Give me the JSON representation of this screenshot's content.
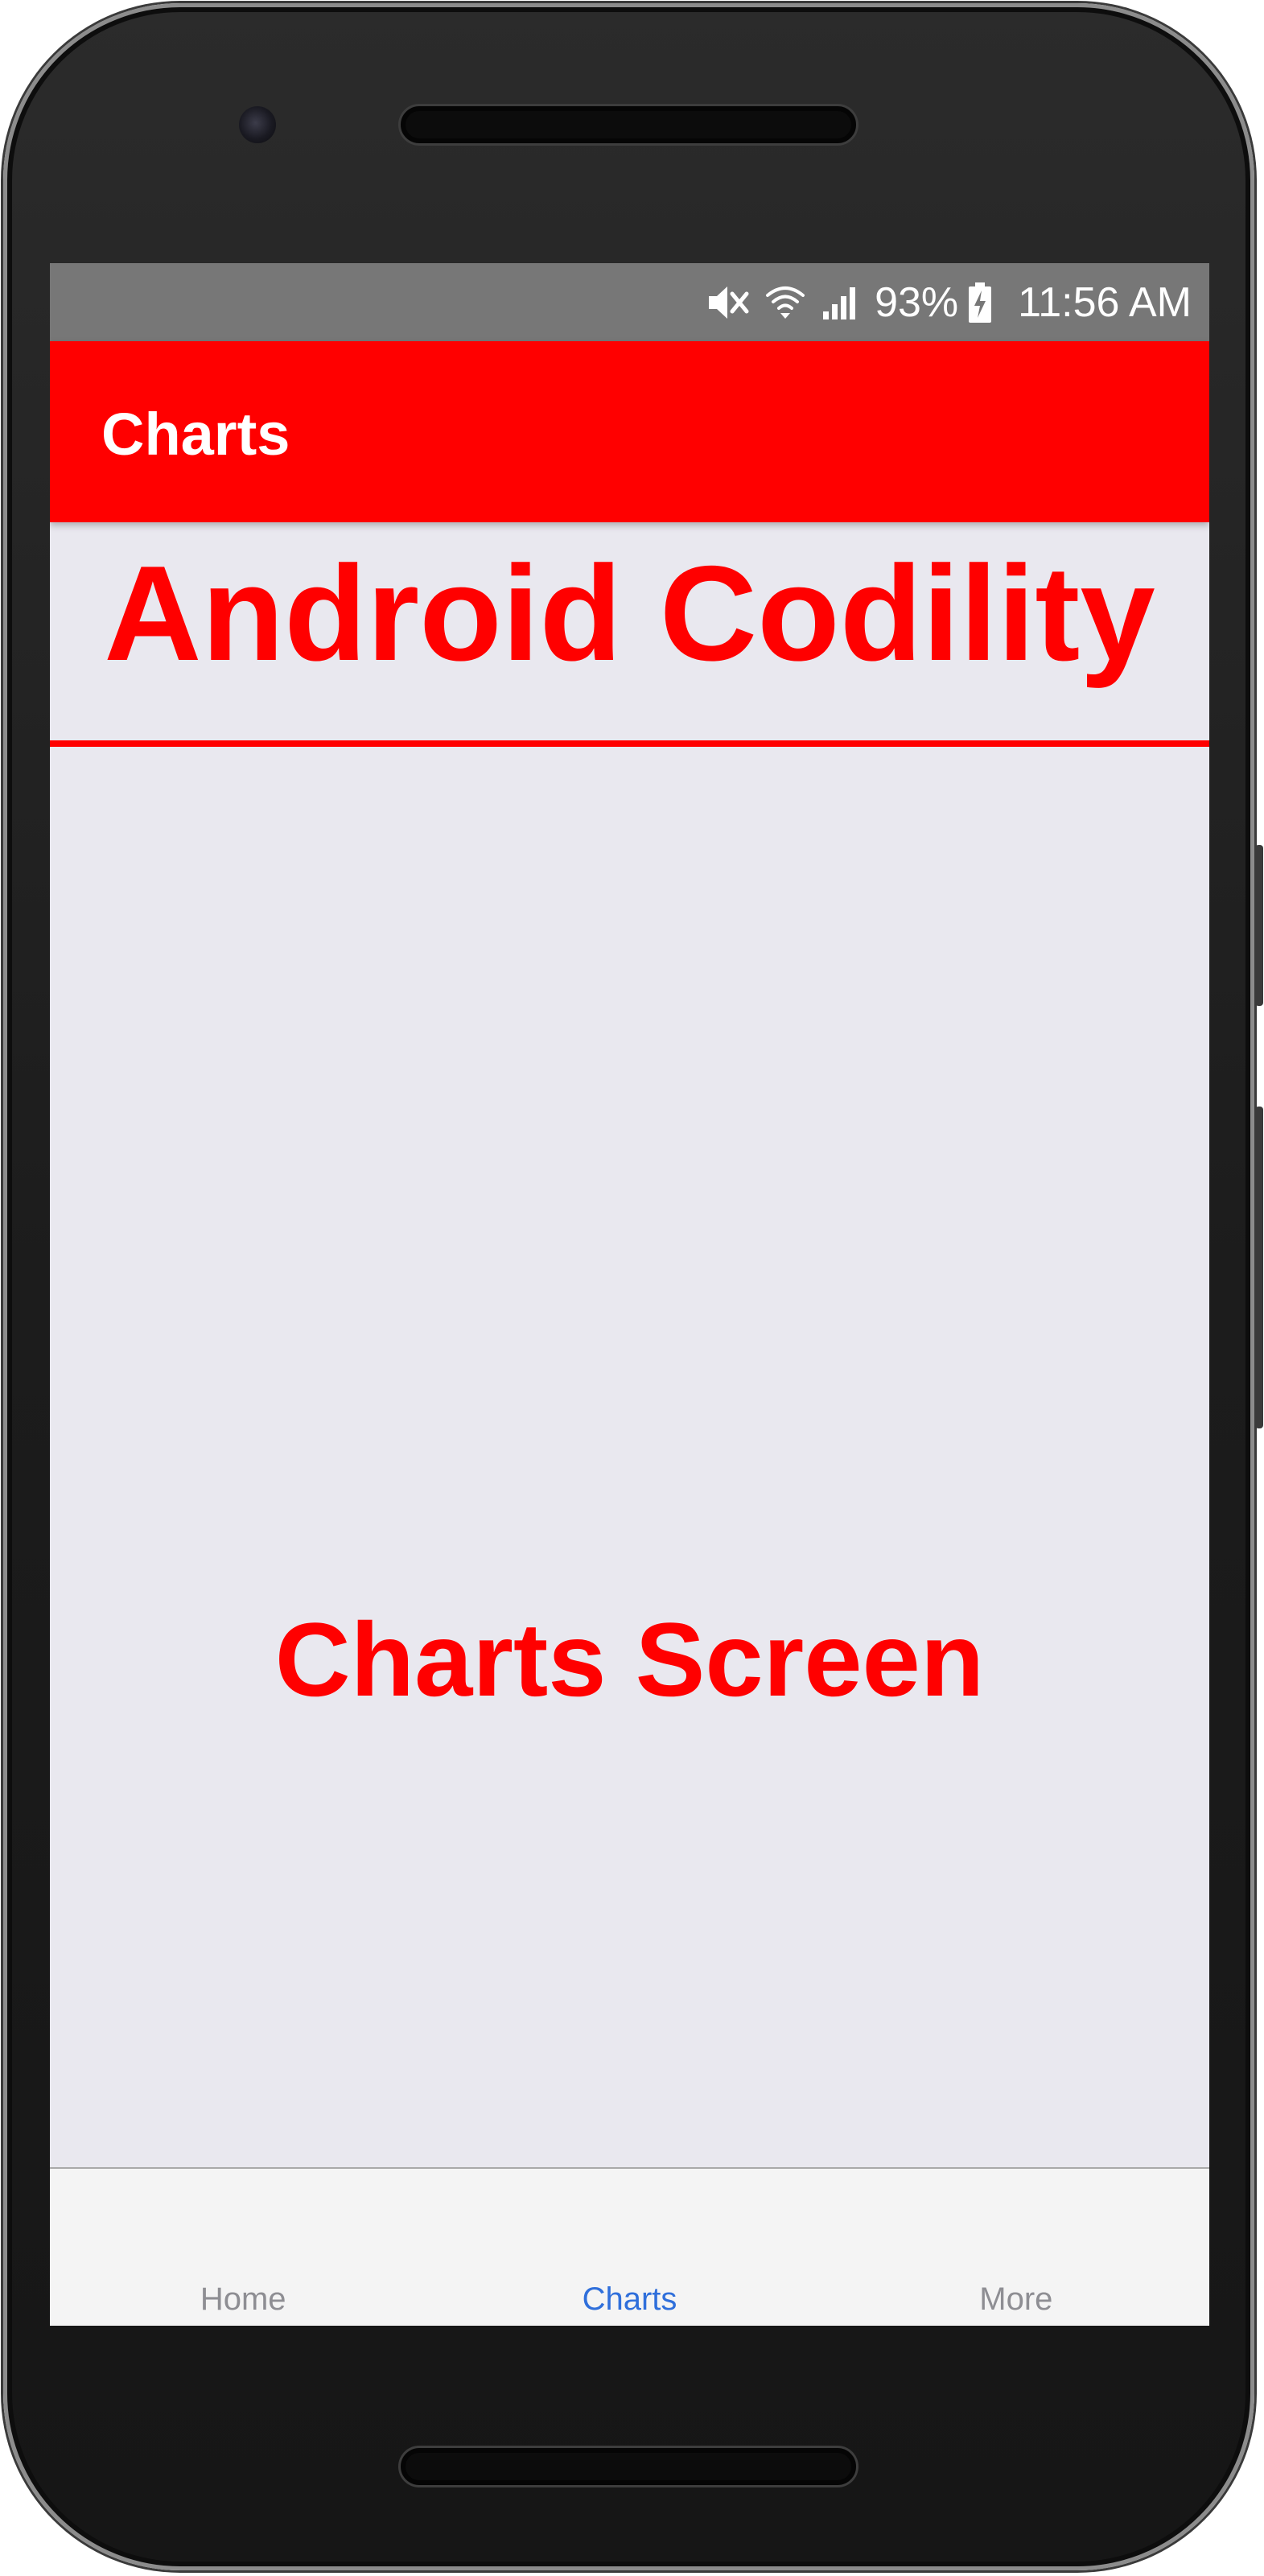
{
  "status_bar": {
    "icons": [
      "mute-icon",
      "wifi-icon",
      "signal-icon",
      "battery-charging-icon"
    ],
    "battery_percent": "93%",
    "time": "11:56 AM"
  },
  "app_bar": {
    "title": "Charts"
  },
  "content": {
    "heading": "Android Codility",
    "body_text": "Charts Screen"
  },
  "tabs": [
    {
      "label": "Home",
      "active": false
    },
    {
      "label": "Charts",
      "active": true
    },
    {
      "label": "More",
      "active": false
    }
  ],
  "colors": {
    "accent": "#ff0000",
    "status_bar": "#777777",
    "screen_background": "#e9e8ef",
    "tab_bar_background": "#f4f4f4",
    "tab_active": "#2f6fdb",
    "tab_inactive": "#8e8e93"
  }
}
